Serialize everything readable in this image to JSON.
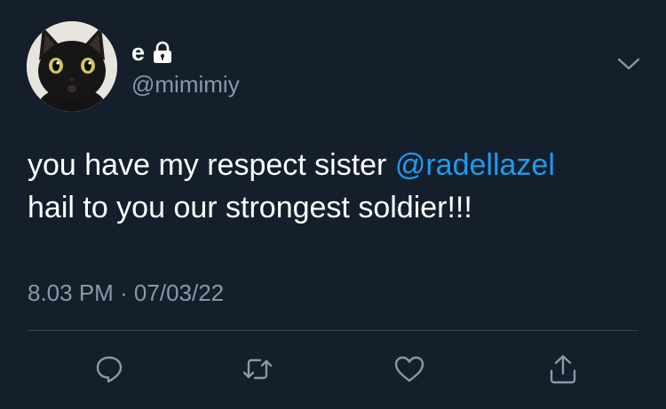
{
  "tweet": {
    "display_name": "e",
    "handle": "@mimimiy",
    "text_part1": "you have my respect sister ",
    "mention": "@radellazel",
    "text_part2": "hail to you our strongest soldier!!!",
    "timestamp": "8.03 PM · 07/03/22"
  },
  "icons": {
    "avatar": "black-cat-avatar",
    "lock": "lock-icon",
    "more": "chevron-down-icon",
    "reply": "reply-icon",
    "retweet": "retweet-icon",
    "like": "heart-icon",
    "share": "share-icon"
  },
  "colors": {
    "background": "#151f2b",
    "text": "#ffffff",
    "secondary": "#8899a6",
    "mention": "#1d9bf0",
    "divider": "#38444d"
  }
}
